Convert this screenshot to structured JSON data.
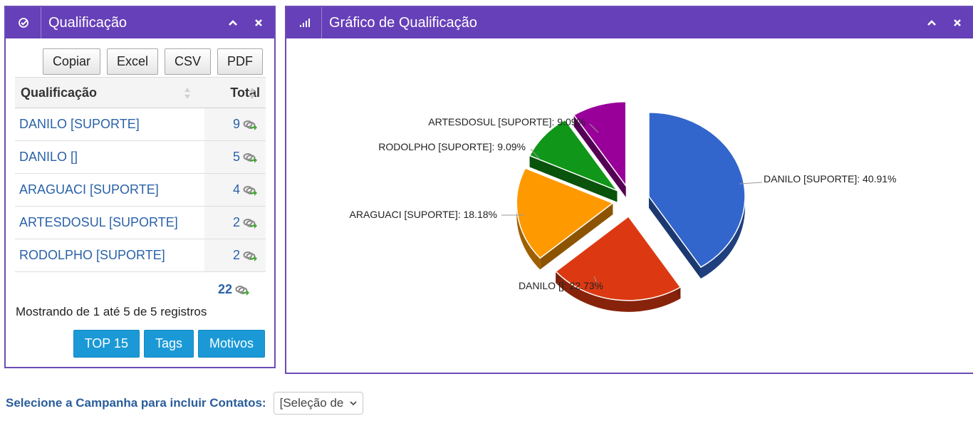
{
  "left_panel": {
    "title": "Qualificação",
    "export_buttons": [
      "Copiar",
      "Excel",
      "CSV",
      "PDF"
    ],
    "columns": [
      "Qualificação",
      "Total"
    ],
    "rows": [
      {
        "name": "DANILO [SUPORTE]",
        "total": "9"
      },
      {
        "name": "DANILO []",
        "total": "5"
      },
      {
        "name": "ARAGUACI [SUPORTE]",
        "total": "4"
      },
      {
        "name": "ARTESDOSUL [SUPORTE]",
        "total": "2"
      },
      {
        "name": "RODOLPHO [SUPORTE]",
        "total": "2"
      }
    ],
    "sum_total": "22",
    "showing_text": "Mostrando de 1 até 5 de 5 registros",
    "action_buttons": [
      "TOP 15",
      "Tags",
      "Motivos"
    ]
  },
  "right_panel": {
    "title": "Gráfico de Qualificação"
  },
  "chart_data": {
    "type": "pie",
    "title": "",
    "slices": [
      {
        "label": "DANILO [SUPORTE]: 40.91%",
        "value": 40.91,
        "color": "#3366cc"
      },
      {
        "label": "DANILO []: 22.73%",
        "value": 22.73,
        "color": "#dc3912"
      },
      {
        "label": "ARAGUACI [SUPORTE]: 18.18%",
        "value": 18.18,
        "color": "#ff9900"
      },
      {
        "label": "RODOLPHO [SUPORTE]: 9.09%",
        "value": 9.09,
        "color": "#109618"
      },
      {
        "label": "ARTESDOSUL [SUPORTE]: 9.09%",
        "value": 9.09,
        "color": "#990099"
      }
    ],
    "exploded": true,
    "three_d": true
  },
  "campaign": {
    "label": "Selecione a Campanha para incluir Contatos:",
    "selected": "[Seleção de"
  },
  "colors": {
    "header": "#6640b8",
    "accent_blue": "#1a99d6",
    "link": "#2a62a8"
  },
  "icons": {
    "left_header": "check-circle-icon",
    "right_header": "bar-signal-icon",
    "collapse": "chevron-up-icon",
    "close": "close-icon",
    "row_link": "link-arrow-icon"
  }
}
